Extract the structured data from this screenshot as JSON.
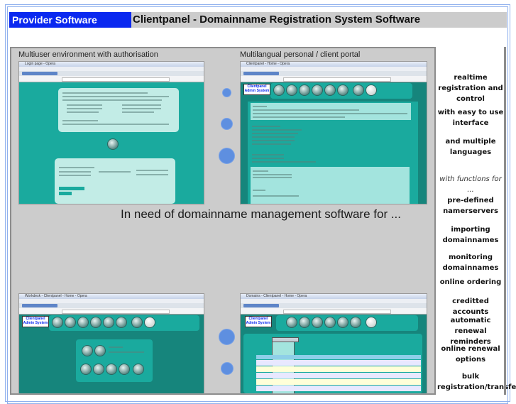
{
  "header": {
    "brand": "Provider Software",
    "title": "Clientpanel - Domainname Registration System Software"
  },
  "screenshots": [
    {
      "caption": "Multiuser environment with authorisation",
      "window_title": "Login page - Opera"
    },
    {
      "caption": "Multilangual personal / client portal",
      "window_title": "Clientpanel - Home - Opera"
    },
    {
      "caption": "",
      "window_title": "Workdesk - Clientpanel - Home - Opera"
    },
    {
      "caption": "",
      "window_title": "Domains - Clientpanel - Home - Opera"
    }
  ],
  "headline": "In need of domainname management software for ...",
  "sidebar": {
    "features": [
      {
        "text": "realtime registration and control",
        "style": "bold"
      },
      {
        "text": "with easy to use interface",
        "style": "bold"
      },
      {
        "text": "and multiple languages",
        "style": "bold"
      },
      {
        "text": "with functions for ...",
        "style": "italic"
      },
      {
        "text": "pre-defined namerservers",
        "style": "bold"
      },
      {
        "text": "importing domainnames",
        "style": "bold"
      },
      {
        "text": "monitoring domainnames",
        "style": "bold"
      },
      {
        "text": "online ordering",
        "style": "bold"
      },
      {
        "text": "creditted accounts",
        "style": "bold"
      },
      {
        "text": "automatic renewal reminders",
        "style": "bold"
      },
      {
        "text": "online renewal options",
        "style": "bold"
      },
      {
        "text": "bulk registration/transfer",
        "style": "bold"
      }
    ]
  },
  "colors": {
    "brand_bg": "#0a28f0",
    "title_bg": "#cccccc",
    "panel_bg": "#cccccc",
    "teal": "#1aaa9e",
    "dot": "#5e8fe0"
  }
}
